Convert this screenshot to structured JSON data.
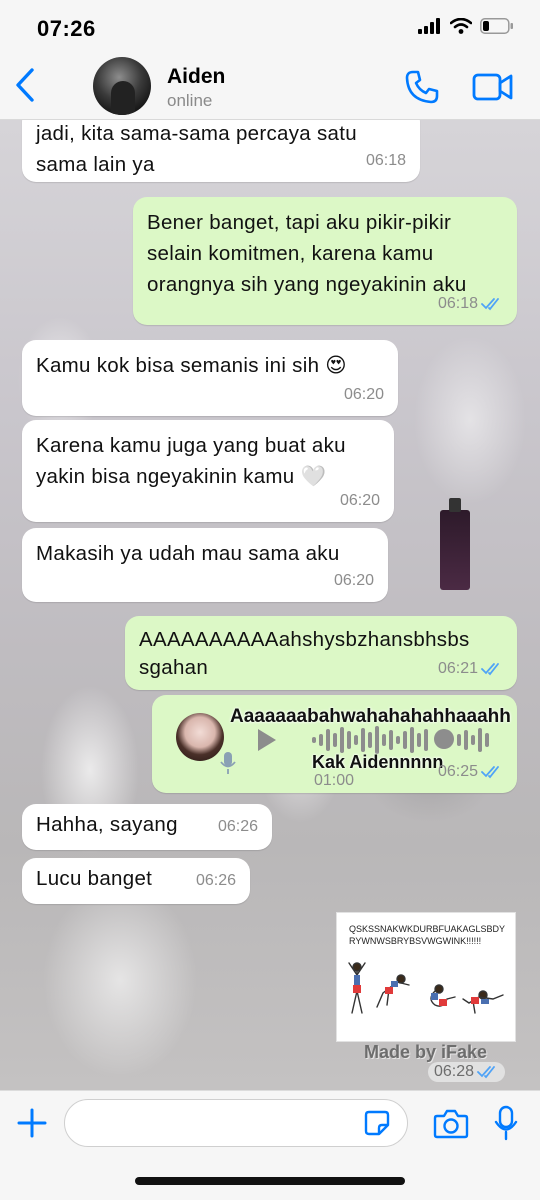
{
  "status_bar": {
    "time": "07:26"
  },
  "header": {
    "name": "Aiden",
    "status": "online"
  },
  "messages": [
    {
      "text_line1": "jadi, kita sama-sama percaya satu",
      "text_line2": "sama lain ya",
      "time": "06:18"
    },
    {
      "text_line1": "Bener banget, tapi aku pikir-pikir",
      "text_line2": "selain komitmen, karena kamu",
      "text_line3": "orangnya sih yang ngeyakinin aku",
      "time": "06:18"
    },
    {
      "text": "Kamu kok bisa semanis ini sih 😍",
      "time": "06:20"
    },
    {
      "text_line1": "Karena kamu juga yang buat aku",
      "text_line2": "yakin bisa ngeyakinin kamu 🤍",
      "time": "06:20"
    },
    {
      "text": "Makasih ya udah mau sama aku",
      "time": "06:20"
    },
    {
      "text_line1": "AAAAAAAAAAahshysbzhansbhsbs",
      "text_line2": "sgahan",
      "time": "06:21"
    },
    {
      "overlay_line1": "Aaaaaaabahwahahahahhaaahh",
      "overlay_line2": "Kak Aidennnnn",
      "duration": "01:00",
      "time": "06:25"
    },
    {
      "text": "Hahha, sayang",
      "time": "06:26"
    },
    {
      "text": "Lucu banget",
      "time": "06:26"
    },
    {
      "sticker_text": "QSKSSNAKWKDURBFUAKAGLSBDYRYWNWSBRYBSVWGWINK!!!!!!",
      "watermark": "Made by iFake",
      "time": "06:28"
    }
  ],
  "input": {
    "placeholder": ""
  },
  "colors": {
    "accent": "#007aff",
    "outgoing_bubble": "#dcf8c6",
    "incoming_bubble": "#ffffff",
    "read_ticks": "#4fa3f7"
  }
}
